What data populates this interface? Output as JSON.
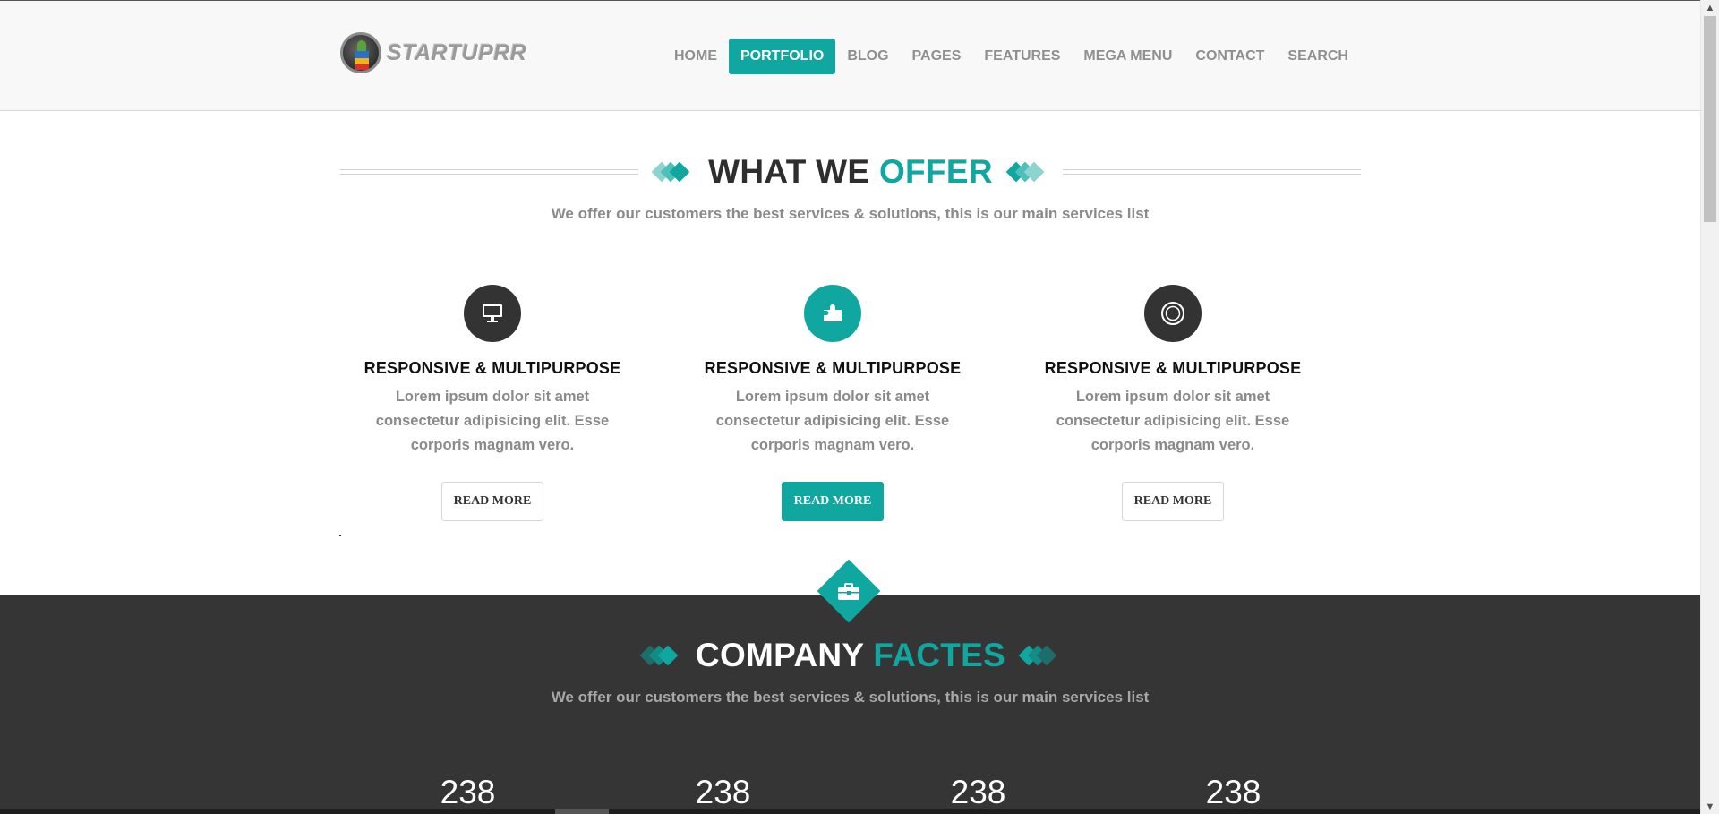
{
  "brand": {
    "name": "STARTUPRR"
  },
  "nav": {
    "items": [
      {
        "label": "HOME",
        "active": false
      },
      {
        "label": "PORTFOLIO",
        "active": true
      },
      {
        "label": "BLOG",
        "active": false
      },
      {
        "label": "PAGES",
        "active": false
      },
      {
        "label": "FEATURES",
        "active": false
      },
      {
        "label": "MEGA MENU",
        "active": false
      },
      {
        "label": "CONTACT",
        "active": false
      },
      {
        "label": "SEARCH",
        "active": false
      }
    ]
  },
  "offer": {
    "title_main": "WHAT WE ",
    "title_accent": "OFFER",
    "subtitle": "We offer our customers the best services & solutions, this is our main services list",
    "features": [
      {
        "icon": "desktop-icon",
        "title": "RESPONSIVE & MULTIPURPOSE",
        "text": "Lorem ipsum dolor sit amet consectetur adipisicing elit. Esse corporis magnam vero.",
        "button": "READ MORE"
      },
      {
        "icon": "puzzle-icon",
        "title": "RESPONSIVE & MULTIPURPOSE",
        "text": "Lorem ipsum dolor sit amet consectetur adipisicing elit. Esse corporis magnam vero.",
        "button": "READ MORE"
      },
      {
        "icon": "circle-target-icon",
        "title": "RESPONSIVE & MULTIPURPOSE",
        "text": "Lorem ipsum dolor sit amet consectetur adipisicing elit. Esse corporis magnam vero.",
        "button": "READ MORE"
      }
    ]
  },
  "facts": {
    "title_main": "COMPANY ",
    "title_accent": "FACTES",
    "subtitle": "We offer our customers the best services & solutions, this is our main services list",
    "counts": [
      "238",
      "238",
      "238",
      "238"
    ]
  },
  "colors": {
    "accent": "#0fa7a0",
    "dark": "#353535",
    "text_muted": "#8a8a8a"
  }
}
